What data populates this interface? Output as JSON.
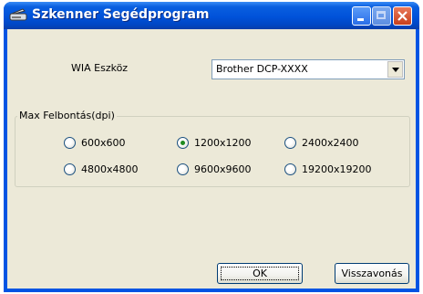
{
  "window": {
    "title": "Szkenner Segédprogram",
    "icon": "scanner-icon",
    "controls": [
      "minimize",
      "maximize",
      "close"
    ]
  },
  "device": {
    "label": "WIA Eszköz",
    "selected": "Brother DCP-XXXX"
  },
  "resolution": {
    "label": "Max Felbontás(dpi)",
    "options": [
      {
        "label": "600x600",
        "checked": false
      },
      {
        "label": "1200x1200",
        "checked": true
      },
      {
        "label": "2400x2400",
        "checked": false
      },
      {
        "label": "4800x4800",
        "checked": false
      },
      {
        "label": "9600x9600",
        "checked": false
      },
      {
        "label": "19200x19200",
        "checked": false
      }
    ]
  },
  "buttons": {
    "ok": "OK",
    "cancel": "Visszavonás"
  }
}
